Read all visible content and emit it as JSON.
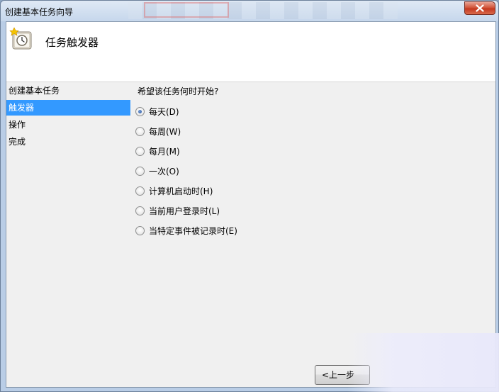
{
  "window": {
    "title": "创建基本任务向导"
  },
  "header": {
    "title": "任务触发器",
    "icon": "task-scheduler-clock-icon"
  },
  "nav": {
    "items": [
      {
        "label": "创建基本任务",
        "selected": false
      },
      {
        "label": "触发器",
        "selected": true
      },
      {
        "label": "操作",
        "selected": false
      },
      {
        "label": "完成",
        "selected": false
      }
    ]
  },
  "main": {
    "question": "希望该任务何时开始?",
    "options": [
      {
        "label": "每天(D)",
        "checked": true
      },
      {
        "label": "每周(W)",
        "checked": false
      },
      {
        "label": "每月(M)",
        "checked": false
      },
      {
        "label": "一次(O)",
        "checked": false
      },
      {
        "label": "计算机启动时(H)",
        "checked": false
      },
      {
        "label": "当前用户登录时(L)",
        "checked": false
      },
      {
        "label": "当特定事件被记录时(E)",
        "checked": false
      }
    ]
  },
  "footer": {
    "back_label": "<上一步"
  },
  "colors": {
    "selection": "#3399ff",
    "close_button": "#c4381f",
    "content_bg": "#f0f0f0"
  }
}
